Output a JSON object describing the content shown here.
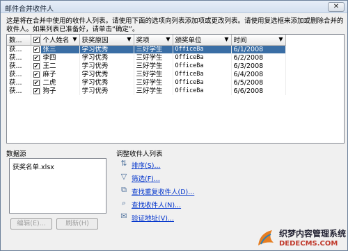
{
  "dialog": {
    "title": "邮件合并收件人",
    "close_label": "✕",
    "intro": "这是将在合并中使用的收件人列表。请使用下面的选项向列表添加项或更改列表。请使用复选框来添加或删除合并的收件人。如果列表已准备好，请单击“确定”。"
  },
  "table": {
    "headers": [
      "数...",
      "",
      "个人姓名",
      "获奖原因",
      "奖项",
      "颁奖单位",
      "时间"
    ],
    "rows": [
      {
        "src": "获...",
        "checked": "✔",
        "name": "张三",
        "reason": "学习优秀",
        "award": "三好学生",
        "org": "OfficeBa",
        "date": "6/1/2008"
      },
      {
        "src": "获...",
        "checked": "✔",
        "name": "李四",
        "reason": "学习优秀",
        "award": "三好学生",
        "org": "OfficeBa",
        "date": "6/2/2008"
      },
      {
        "src": "获...",
        "checked": "✔",
        "name": "王二",
        "reason": "学习优秀",
        "award": "三好学生",
        "org": "OfficeBa",
        "date": "6/3/2008"
      },
      {
        "src": "获...",
        "checked": "✔",
        "name": "麻子",
        "reason": "学习优秀",
        "award": "三好学生",
        "org": "OfficeBa",
        "date": "6/4/2008"
      },
      {
        "src": "获...",
        "checked": "✔",
        "name": "二虎",
        "reason": "学习优秀",
        "award": "三好学生",
        "org": "OfficeBa",
        "date": "6/5/2008"
      },
      {
        "src": "获...",
        "checked": "✔",
        "name": "狗子",
        "reason": "学习优秀",
        "award": "三好学生",
        "org": "OfficeBa",
        "date": "6/6/2008"
      }
    ]
  },
  "datasource": {
    "label": "数据源",
    "item": "获奖名单.xlsx",
    "edit_label": "编辑(E)...",
    "refresh_label": "刷新(H)"
  },
  "adjust": {
    "label": "调整收件人列表",
    "links": [
      {
        "icon": "sort-icon",
        "glyph": "⇅",
        "label": "排序(S)..."
      },
      {
        "icon": "filter-icon",
        "glyph": "▽",
        "label": "筛选(F)..."
      },
      {
        "icon": "find-duplicates-icon",
        "glyph": "⧉",
        "label": "查找重复收件人(D)..."
      },
      {
        "icon": "find-recipient-icon",
        "glyph": "⌕",
        "label": "查找收件人(N)..."
      },
      {
        "icon": "validate-address-icon",
        "glyph": "✉",
        "label": "验证地址(V)..."
      }
    ]
  },
  "watermark": {
    "brand": "织梦内容管理系统",
    "url": "DEDECMS.COM"
  },
  "colors": {
    "selection": "#3a6ea5",
    "link": "#0033cc"
  }
}
